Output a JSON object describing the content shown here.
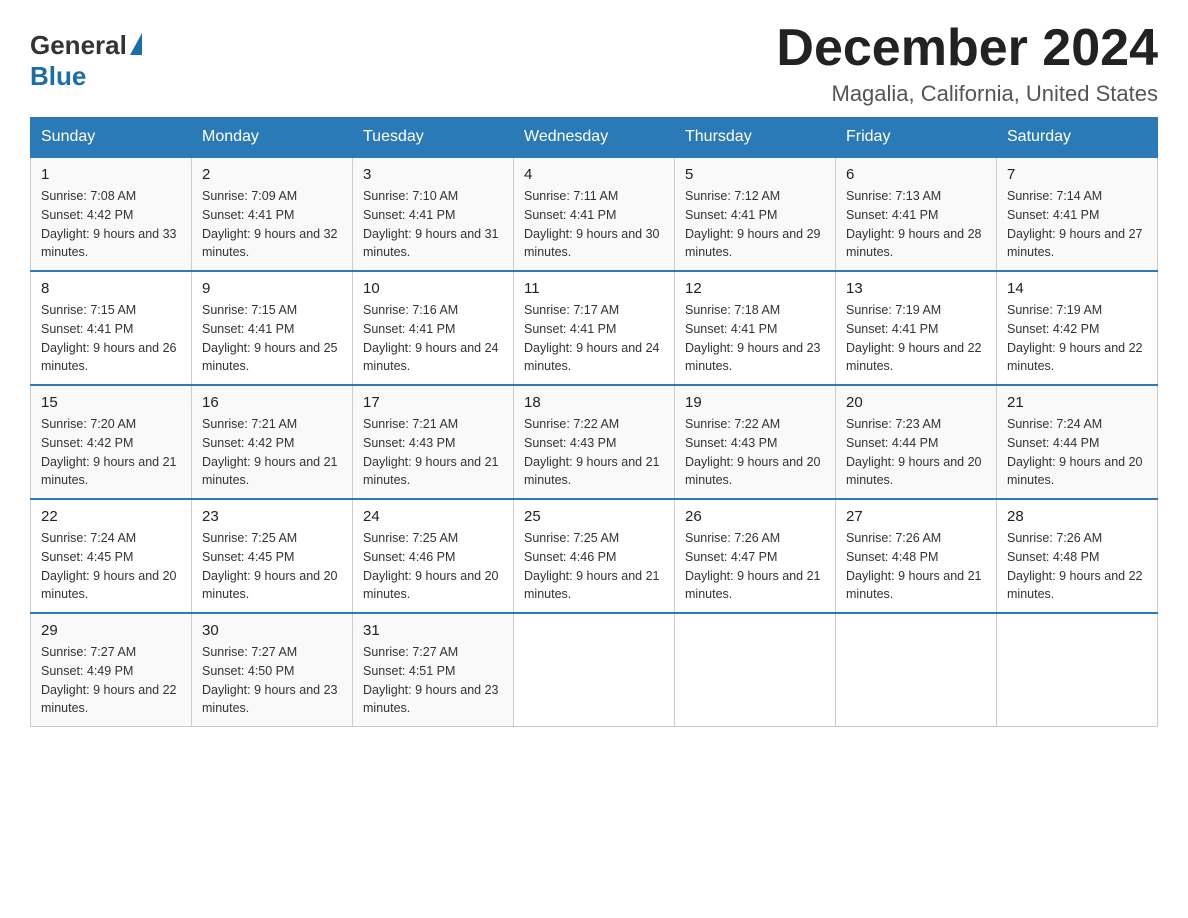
{
  "header": {
    "logo": {
      "general": "General",
      "blue": "Blue"
    },
    "title": "December 2024",
    "location": "Magalia, California, United States"
  },
  "calendar": {
    "weekdays": [
      "Sunday",
      "Monday",
      "Tuesday",
      "Wednesday",
      "Thursday",
      "Friday",
      "Saturday"
    ],
    "weeks": [
      [
        {
          "day": "1",
          "sunrise": "7:08 AM",
          "sunset": "4:42 PM",
          "daylight": "9 hours and 33 minutes."
        },
        {
          "day": "2",
          "sunrise": "7:09 AM",
          "sunset": "4:41 PM",
          "daylight": "9 hours and 32 minutes."
        },
        {
          "day": "3",
          "sunrise": "7:10 AM",
          "sunset": "4:41 PM",
          "daylight": "9 hours and 31 minutes."
        },
        {
          "day": "4",
          "sunrise": "7:11 AM",
          "sunset": "4:41 PM",
          "daylight": "9 hours and 30 minutes."
        },
        {
          "day": "5",
          "sunrise": "7:12 AM",
          "sunset": "4:41 PM",
          "daylight": "9 hours and 29 minutes."
        },
        {
          "day": "6",
          "sunrise": "7:13 AM",
          "sunset": "4:41 PM",
          "daylight": "9 hours and 28 minutes."
        },
        {
          "day": "7",
          "sunrise": "7:14 AM",
          "sunset": "4:41 PM",
          "daylight": "9 hours and 27 minutes."
        }
      ],
      [
        {
          "day": "8",
          "sunrise": "7:15 AM",
          "sunset": "4:41 PM",
          "daylight": "9 hours and 26 minutes."
        },
        {
          "day": "9",
          "sunrise": "7:15 AM",
          "sunset": "4:41 PM",
          "daylight": "9 hours and 25 minutes."
        },
        {
          "day": "10",
          "sunrise": "7:16 AM",
          "sunset": "4:41 PM",
          "daylight": "9 hours and 24 minutes."
        },
        {
          "day": "11",
          "sunrise": "7:17 AM",
          "sunset": "4:41 PM",
          "daylight": "9 hours and 24 minutes."
        },
        {
          "day": "12",
          "sunrise": "7:18 AM",
          "sunset": "4:41 PM",
          "daylight": "9 hours and 23 minutes."
        },
        {
          "day": "13",
          "sunrise": "7:19 AM",
          "sunset": "4:41 PM",
          "daylight": "9 hours and 22 minutes."
        },
        {
          "day": "14",
          "sunrise": "7:19 AM",
          "sunset": "4:42 PM",
          "daylight": "9 hours and 22 minutes."
        }
      ],
      [
        {
          "day": "15",
          "sunrise": "7:20 AM",
          "sunset": "4:42 PM",
          "daylight": "9 hours and 21 minutes."
        },
        {
          "day": "16",
          "sunrise": "7:21 AM",
          "sunset": "4:42 PM",
          "daylight": "9 hours and 21 minutes."
        },
        {
          "day": "17",
          "sunrise": "7:21 AM",
          "sunset": "4:43 PM",
          "daylight": "9 hours and 21 minutes."
        },
        {
          "day": "18",
          "sunrise": "7:22 AM",
          "sunset": "4:43 PM",
          "daylight": "9 hours and 21 minutes."
        },
        {
          "day": "19",
          "sunrise": "7:22 AM",
          "sunset": "4:43 PM",
          "daylight": "9 hours and 20 minutes."
        },
        {
          "day": "20",
          "sunrise": "7:23 AM",
          "sunset": "4:44 PM",
          "daylight": "9 hours and 20 minutes."
        },
        {
          "day": "21",
          "sunrise": "7:24 AM",
          "sunset": "4:44 PM",
          "daylight": "9 hours and 20 minutes."
        }
      ],
      [
        {
          "day": "22",
          "sunrise": "7:24 AM",
          "sunset": "4:45 PM",
          "daylight": "9 hours and 20 minutes."
        },
        {
          "day": "23",
          "sunrise": "7:25 AM",
          "sunset": "4:45 PM",
          "daylight": "9 hours and 20 minutes."
        },
        {
          "day": "24",
          "sunrise": "7:25 AM",
          "sunset": "4:46 PM",
          "daylight": "9 hours and 20 minutes."
        },
        {
          "day": "25",
          "sunrise": "7:25 AM",
          "sunset": "4:46 PM",
          "daylight": "9 hours and 21 minutes."
        },
        {
          "day": "26",
          "sunrise": "7:26 AM",
          "sunset": "4:47 PM",
          "daylight": "9 hours and 21 minutes."
        },
        {
          "day": "27",
          "sunrise": "7:26 AM",
          "sunset": "4:48 PM",
          "daylight": "9 hours and 21 minutes."
        },
        {
          "day": "28",
          "sunrise": "7:26 AM",
          "sunset": "4:48 PM",
          "daylight": "9 hours and 22 minutes."
        }
      ],
      [
        {
          "day": "29",
          "sunrise": "7:27 AM",
          "sunset": "4:49 PM",
          "daylight": "9 hours and 22 minutes."
        },
        {
          "day": "30",
          "sunrise": "7:27 AM",
          "sunset": "4:50 PM",
          "daylight": "9 hours and 23 minutes."
        },
        {
          "day": "31",
          "sunrise": "7:27 AM",
          "sunset": "4:51 PM",
          "daylight": "9 hours and 23 minutes."
        },
        null,
        null,
        null,
        null
      ]
    ]
  }
}
